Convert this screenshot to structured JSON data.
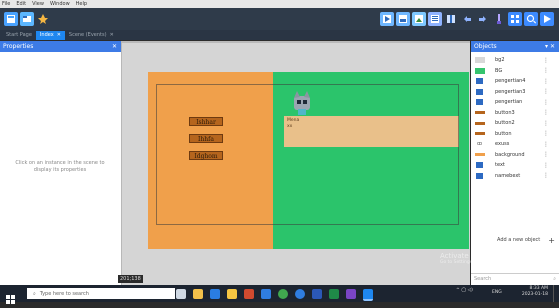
{
  "menu": [
    "File",
    "Edit",
    "View",
    "Window",
    "Help"
  ],
  "toolbar_left": [
    {
      "name": "new-project-icon",
      "color": "#4aa3ff"
    },
    {
      "name": "open-project-icon",
      "color": "#5cb7ff"
    },
    {
      "name": "build-tool-icon",
      "color": "#f5b642"
    }
  ],
  "toolbar_right": [
    {
      "name": "run-icon",
      "color": "#6fb7ff"
    },
    {
      "name": "export-icon",
      "color": "#6fb7ff"
    },
    {
      "name": "image-icon",
      "color": "#7ec8ff"
    },
    {
      "name": "layout-icon",
      "color": "#8fb3ff"
    },
    {
      "name": "book-icon",
      "color": "#8fb3ff"
    },
    {
      "name": "undo-icon",
      "color": "#8fb3ff"
    },
    {
      "name": "redo-icon",
      "color": "#8fb3ff"
    },
    {
      "name": "brush-icon",
      "color": "#b4a6ff"
    },
    {
      "name": "grid-icon",
      "color": "#3d8bff"
    },
    {
      "name": "zoom-icon",
      "color": "#3d8bff"
    },
    {
      "name": "preview-icon",
      "color": "#3d8bff"
    }
  ],
  "tabs": [
    {
      "label": "Start Page",
      "active": false
    },
    {
      "label": "Index",
      "active": true
    },
    {
      "label": "Scene (Events)",
      "active": false
    }
  ],
  "properties": {
    "title": "Properties",
    "empty_message": "Click on an instance in the scene to display its properties"
  },
  "scene": {
    "buttons": [
      "Ishhar",
      "Ihhfa",
      "Idghom"
    ],
    "textbox_line1": "Mena",
    "textbox_line2": "xx",
    "coords": "201;138"
  },
  "objects": {
    "title": "Objects",
    "add_label": "Add a new object",
    "items": [
      {
        "name": "bg2",
        "icon": "rect",
        "color": "#d8d8d8"
      },
      {
        "name": "BG",
        "icon": "rect",
        "color": "#35c46e"
      },
      {
        "name": "pengertian4",
        "icon": "text",
        "color": "#2d6ac2"
      },
      {
        "name": "pengertian3",
        "icon": "text",
        "color": "#2d6ac2"
      },
      {
        "name": "pengertian",
        "icon": "text",
        "color": "#2d6ac2"
      },
      {
        "name": "button3",
        "icon": "bar",
        "color": "#b5651d"
      },
      {
        "name": "button2",
        "icon": "bar",
        "color": "#b5651d"
      },
      {
        "name": "button",
        "icon": "bar",
        "color": "#b5651d"
      },
      {
        "name": "exuss",
        "icon": "sprite",
        "color": "#777777"
      },
      {
        "name": "background",
        "icon": "bar",
        "color": "#f0a04b"
      },
      {
        "name": "text",
        "icon": "text",
        "color": "#2d6ac2"
      },
      {
        "name": "namebext",
        "icon": "text",
        "color": "#2d6ac2"
      }
    ]
  },
  "activate": {
    "title": "Activate Windows",
    "subtitle": "Go to Settings to activate Windows."
  },
  "search_placeholder": "Search",
  "taskbar": {
    "search_placeholder": "Type here to search",
    "apps": [
      "task-view-icon",
      "explorer-icon",
      "store-icon",
      "files-icon",
      "office-icon",
      "mail-icon",
      "chrome-icon",
      "edge-icon",
      "word-icon",
      "excel-icon",
      "app-icon",
      "editor-icon"
    ],
    "app_colors": [
      "#cfd8e3",
      "#f3c14b",
      "#2a7de1",
      "#f5c542",
      "#d04a2f",
      "#2f7de1",
      "#40a84f",
      "#2f7de1",
      "#2b58b8",
      "#1f8a48",
      "#7a45c6",
      "#1e87f0"
    ],
    "lang": "ENG",
    "time": "8:33 AM",
    "date": "2023-01-18"
  }
}
